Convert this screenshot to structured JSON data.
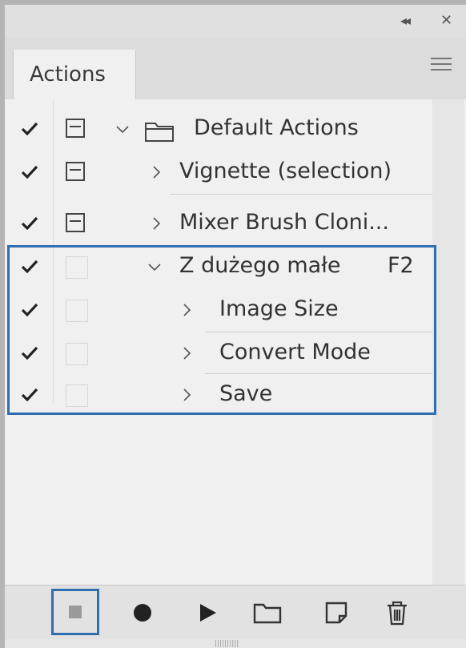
{
  "panel": {
    "tab_label": "Actions"
  },
  "rows": [
    {
      "label": "Default Actions",
      "type": "set",
      "expanded": true,
      "checked": true,
      "dialog": true,
      "icon": "folder-icon"
    },
    {
      "label": "Vignette (selection)",
      "type": "action",
      "expanded": false,
      "checked": true,
      "dialog": true
    },
    {
      "label": "Mixer Brush Cloni...",
      "type": "action",
      "expanded": false,
      "checked": true,
      "dialog": true
    },
    {
      "label": "Z dużego małe",
      "type": "action",
      "expanded": true,
      "checked": true,
      "dialog": false,
      "shortcut": "F2"
    },
    {
      "label": "Image Size",
      "type": "step",
      "expanded": false,
      "checked": true,
      "dialog": false
    },
    {
      "label": "Convert Mode",
      "type": "step",
      "expanded": false,
      "checked": true,
      "dialog": false
    },
    {
      "label": "Save",
      "type": "step",
      "expanded": false,
      "checked": true,
      "dialog": false
    }
  ],
  "toolbar": {
    "buttons": [
      "stop-playing-recording",
      "begin-recording",
      "play-selection",
      "create-new-set",
      "create-new-action",
      "delete"
    ]
  },
  "colors": {
    "highlight": "#2f6fb0",
    "panel_bg": "#f0f0f0"
  }
}
